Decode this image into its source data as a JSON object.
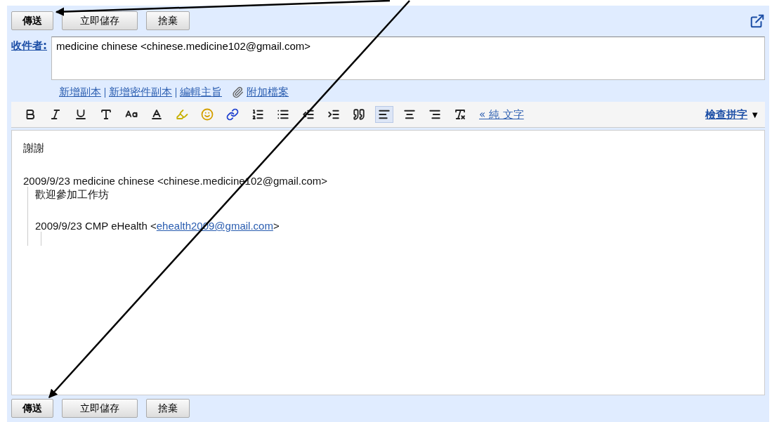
{
  "top_actions": [
    {
      "label": "傳送",
      "primary": true
    },
    {
      "label": "立即儲存",
      "primary": false
    },
    {
      "label": "捨棄",
      "primary": false
    }
  ],
  "recipients": {
    "label": "收件者:",
    "value": "medicine chinese <chinese.medicine102@gmail.com>"
  },
  "field_links": [
    "新增副本",
    "新增密件副本",
    "編輯主旨"
  ],
  "attach_link": "附加檔案",
  "format_toolbar": {
    "buttons": [
      {
        "selected": false
      },
      {
        "selected": false
      },
      {
        "selected": false
      },
      {
        "selected": false
      },
      {
        "selected": false
      },
      {
        "selected": false
      },
      {
        "selected": false
      },
      {
        "selected": false
      },
      {
        "selected": false
      },
      {
        "selected": false
      },
      {
        "selected": false
      },
      {
        "selected": false
      },
      {
        "selected": false
      },
      {
        "selected": false
      },
      {
        "selected": true
      },
      {
        "selected": false
      },
      {
        "selected": false
      },
      {
        "selected": false
      }
    ],
    "plain_text_link": "« 純 文字",
    "spellcheck": "檢查拼字",
    "spellcheck_caret": "▼"
  },
  "body": {
    "first_line": "謝謝",
    "quote_header": "2009/9/23 medicine chinese <chinese.medicine102@gmail.com>",
    "quote": {
      "line": "歡迎參加工作坊",
      "header_prefix": "2009/9/23 CMP eHealth <",
      "header_link": "ehealth2009@gmail.com",
      "header_suffix": ">"
    }
  },
  "bottom_actions": [
    {
      "label": "傳送",
      "primary": true
    },
    {
      "label": "立即儲存",
      "primary": false
    },
    {
      "label": "捨棄",
      "primary": false
    }
  ]
}
